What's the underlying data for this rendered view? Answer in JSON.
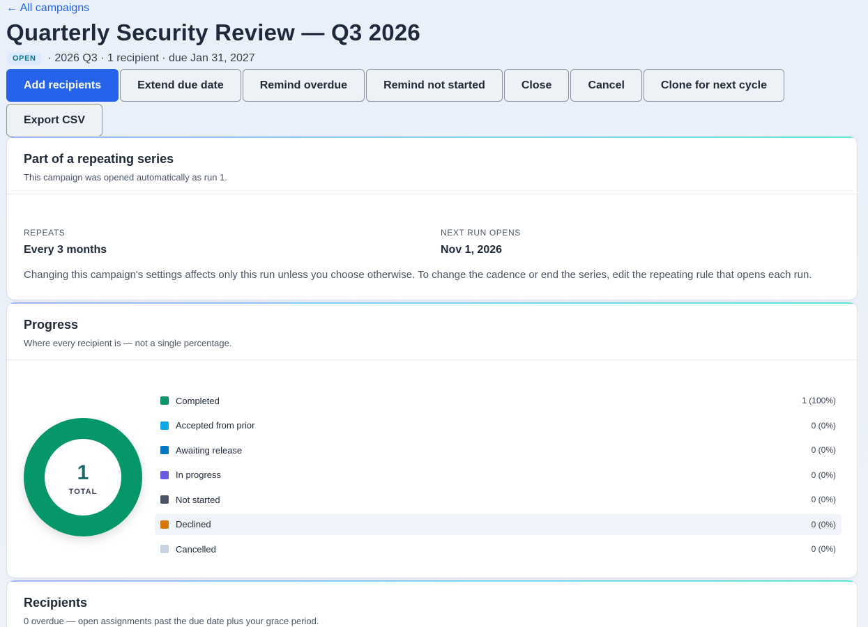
{
  "nav": {
    "back_label": "← All campaigns"
  },
  "header": {
    "title": "Quarterly Security Review — Q3 2026",
    "status": "OPEN",
    "meta": "· 2026 Q3 · 1 recipient · due Jan 31, 2027"
  },
  "actions": [
    {
      "label": "Add recipients",
      "primary": true
    },
    {
      "label": "Extend due date",
      "primary": false
    },
    {
      "label": "Remind overdue",
      "primary": false
    },
    {
      "label": "Remind not started",
      "primary": false
    },
    {
      "label": "Close",
      "primary": false
    },
    {
      "label": "Cancel",
      "primary": false
    },
    {
      "label": "Clone for next cycle",
      "primary": false
    },
    {
      "label": "Export CSV",
      "primary": false
    }
  ],
  "series": {
    "title": "Part of a repeating series",
    "subtitle": "This campaign was opened automatically as run 1.",
    "repeats_label": "REPEATS",
    "repeats_value": "Every 3 months",
    "next_label": "NEXT RUN OPENS",
    "next_value": "Nov 1, 2026",
    "note": "Changing this campaign's settings affects only this run unless you choose otherwise. To change the cadence or end the series, edit the repeating rule that opens each run."
  },
  "progress": {
    "title": "Progress",
    "subtitle": "Where every recipient is — not a single percentage.",
    "total": "1",
    "total_label": "TOTAL",
    "items": [
      {
        "label": "Completed",
        "count": 1,
        "value": "1 (100%)",
        "color": "#059669"
      },
      {
        "label": "Accepted from prior",
        "count": 0,
        "value": "0 (0%)",
        "color": "#0ea5e9"
      },
      {
        "label": "Awaiting release",
        "count": 0,
        "value": "0 (0%)",
        "color": "#0378c4"
      },
      {
        "label": "In progress",
        "count": 0,
        "value": "0 (0%)",
        "color": "#6a5ae0"
      },
      {
        "label": "Not started",
        "count": 0,
        "value": "0 (0%)",
        "color": "#4b5563"
      },
      {
        "label": "Declined",
        "count": 0,
        "value": "0 (0%)",
        "color": "#d97706"
      },
      {
        "label": "Cancelled",
        "count": 0,
        "value": "0 (0%)",
        "color": "#c6d3e0"
      }
    ]
  },
  "recipients": {
    "title": "Recipients",
    "subtitle": "0 overdue — open assignments past the due date plus your grace period."
  }
}
